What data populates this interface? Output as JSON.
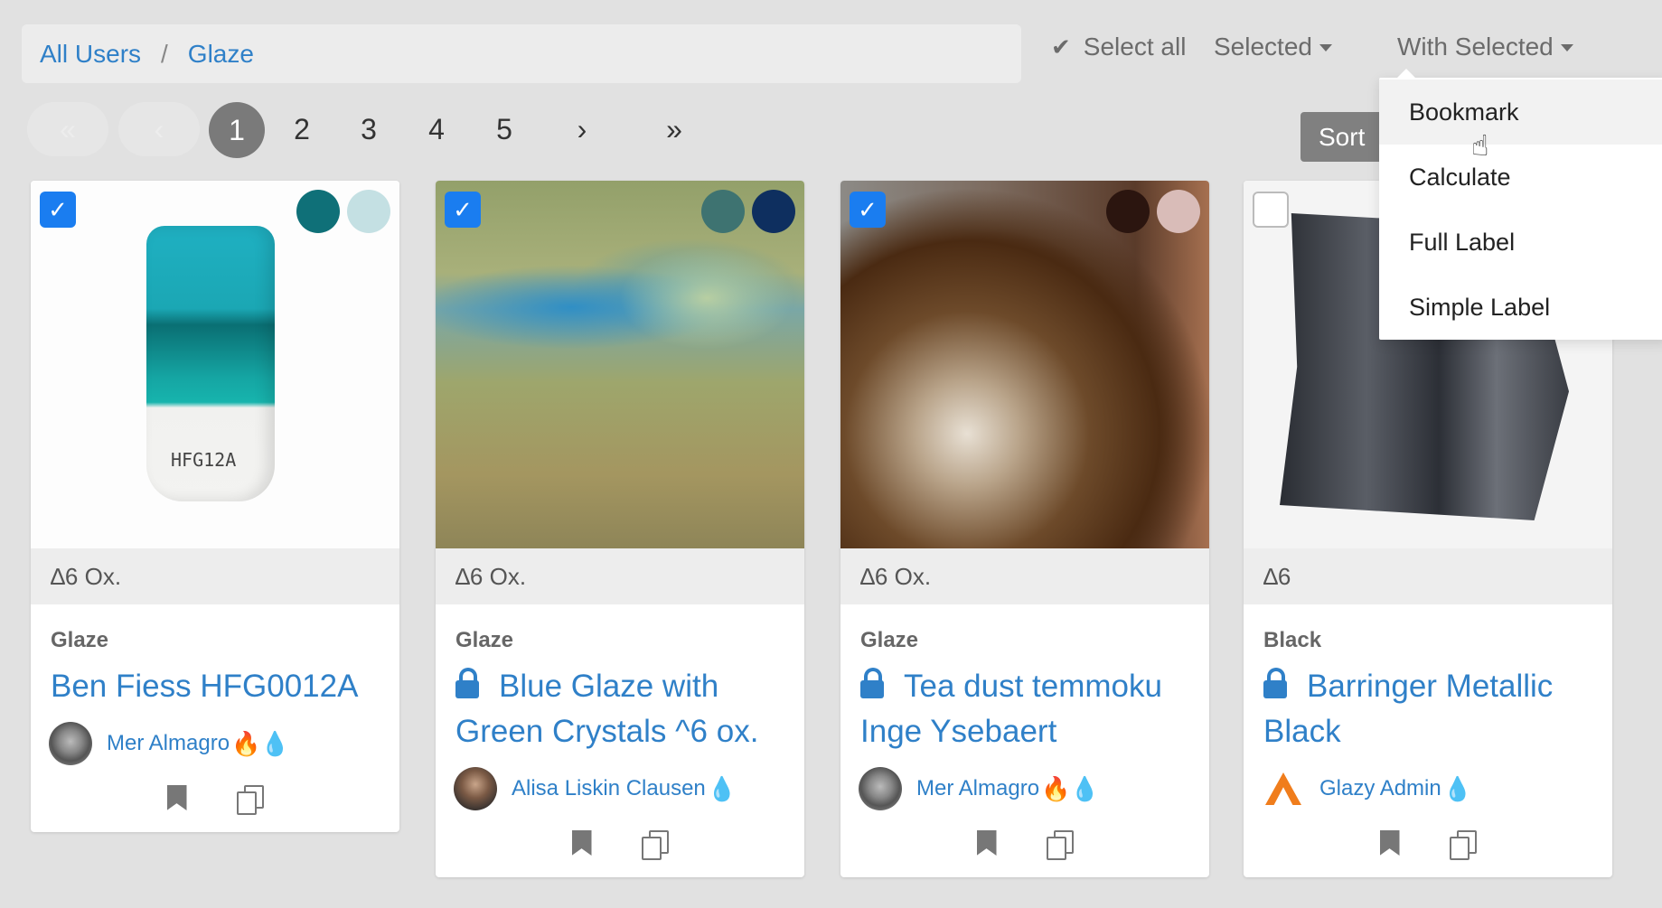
{
  "breadcrumb": {
    "items": [
      "All Users",
      "Glaze"
    ],
    "separator": "/"
  },
  "toolbar": {
    "select_all": "Select all",
    "selected": "Selected",
    "with_selected": "With Selected"
  },
  "pagination": {
    "first": "«",
    "prev": "‹",
    "pages": [
      "1",
      "2",
      "3",
      "4",
      "5"
    ],
    "current": "1",
    "next": "›",
    "last": "»"
  },
  "sort": {
    "label": "Sort"
  },
  "dropdown": {
    "items": [
      "Bookmark",
      "Calculate",
      "Full Label",
      "Simple Label"
    ],
    "hovered": "Bookmark"
  },
  "cards": [
    {
      "checked": true,
      "swatches": [
        "#0f7078",
        "#c4e0e3"
      ],
      "cone": "∆6 Ox.",
      "category": "Glaze",
      "title": "Ben Fiess HFG0012A",
      "locked": false,
      "author": "Mer Almagro",
      "flames": "🔥💧",
      "photo_text": "HFG12A"
    },
    {
      "checked": true,
      "swatches": [
        "#3e7371",
        "#0e2f5f"
      ],
      "cone": "∆6 Ox.",
      "category": "Glaze",
      "title": "Blue Glaze with Green Crystals ^6 ox.",
      "locked": true,
      "author": "Alisa Liskin Clausen",
      "flames": "💧"
    },
    {
      "checked": true,
      "swatches": [
        "#2b150f",
        "#d9bcb8"
      ],
      "cone": "∆6 Ox.",
      "category": "Glaze",
      "title": "Tea dust temmoku Inge Ysebaert",
      "locked": true,
      "author": "Mer Almagro",
      "flames": "🔥💧"
    },
    {
      "checked": false,
      "swatches": [],
      "cone": "∆6",
      "category": "Black",
      "title": "Barringer Metallic Black",
      "locked": true,
      "author": "Glazy Admin",
      "flames": "💧"
    }
  ]
}
